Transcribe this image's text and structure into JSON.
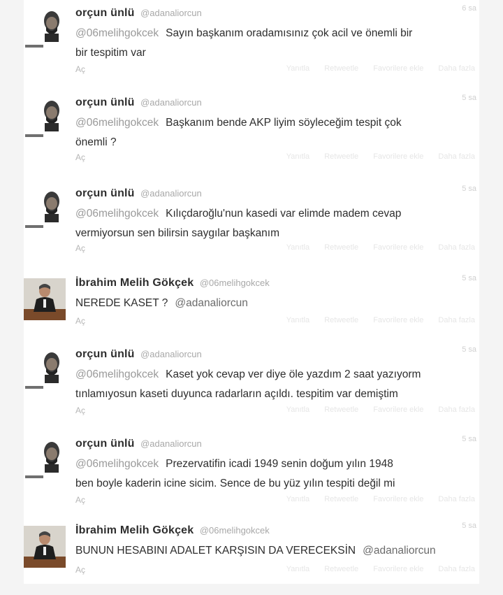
{
  "tweets": [
    {
      "kind": "orcun",
      "name": "orçun ünlü",
      "handle": "@adanaliorcun",
      "time": "6 sa",
      "mention": "@06melihgokcek",
      "text_line1": "Sayın başkanım oradamısınız çok acil ve önemli bir",
      "text_line2": "bir tespitim var",
      "expand": "Aç",
      "actions": [
        "Yanıtla",
        "Retweetle",
        "Favorilere ekle",
        "Daha fazla"
      ]
    },
    {
      "kind": "orcun",
      "name": "orçun ünlü",
      "handle": "@adanaliorcun",
      "time": "5 sa",
      "mention": "@06melihgokcek",
      "text_line1": "Başkanım bende AKP liyim söyleceğim tespit çok",
      "text_line2": "önemli ?",
      "expand": "Aç",
      "actions": [
        "Yanıtla",
        "Retweetle",
        "Favorilere ekle",
        "Daha fazla"
      ]
    },
    {
      "kind": "orcun",
      "name": "orçun ünlü",
      "handle": "@adanaliorcun",
      "time": "5 sa",
      "mention": "@06melihgokcek",
      "text_line1": "Kılıçdaroğlu'nun kasedi var elimde madem cevap",
      "text_line2": "vermiyorsun sen bilirsin saygılar başkanım",
      "expand": "Aç",
      "actions": [
        "Yanıtla",
        "Retweetle",
        "Favorilere ekle",
        "Daha fazla"
      ]
    },
    {
      "kind": "melih",
      "name": "İbrahim Melih Gökçek",
      "handle": "@06melihgokcek",
      "time": "5 sa",
      "text_line1": "NEREDE KASET ?",
      "end_mention": "@adanaliorcun",
      "expand": "Aç",
      "actions": [
        "Yanıtla",
        "Retweetle",
        "Favorilere ekle",
        "Daha fazla"
      ]
    },
    {
      "kind": "orcun",
      "name": "orçun ünlü",
      "handle": "@adanaliorcun",
      "time": "5 sa",
      "mention": "@06melihgokcek",
      "text_line1": "Kaset yok cevap ver diye öle yazdım 2 saat yazıyorm",
      "text_line2": "tınlamıyosun kaseti duyunca radarların açıldı. tespitim var demiştim",
      "expand": "Aç",
      "actions": [
        "Yanıtla",
        "Retweetle",
        "Favorilere ekle",
        "Daha fazla"
      ]
    },
    {
      "kind": "orcun",
      "name": "orçun ünlü",
      "handle": "@adanaliorcun",
      "time": "5 sa",
      "mention": "@06melihgokcek",
      "text_line1": "Prezervatifin icadi 1949 senin doğum yılın 1948",
      "text_line2": "ben boyle kaderin icine sicim. Sence de bu yüz yılın tespiti değil mi",
      "expand": "Aç",
      "actions": [
        "Yanıtla",
        "Retweetle",
        "Favorilere ekle",
        "Daha fazla"
      ]
    },
    {
      "kind": "melih",
      "name": "İbrahim Melih Gökçek",
      "handle": "@06melihgokcek",
      "time": "5 sa",
      "text_line1": "BUNUN HESABINI ADALET KARŞISIN DA VERECEKSİN",
      "end_mention": "@adanaliorcun",
      "expand": "Aç",
      "actions": [
        "Yanıtla",
        "Retweetle",
        "Favorilere ekle",
        "Daha fazla"
      ]
    }
  ],
  "colors": {
    "name": "#2e2e2e",
    "handle": "#a8a8a8",
    "mention": "#9a9a9a",
    "body": "#2d2d2d"
  }
}
